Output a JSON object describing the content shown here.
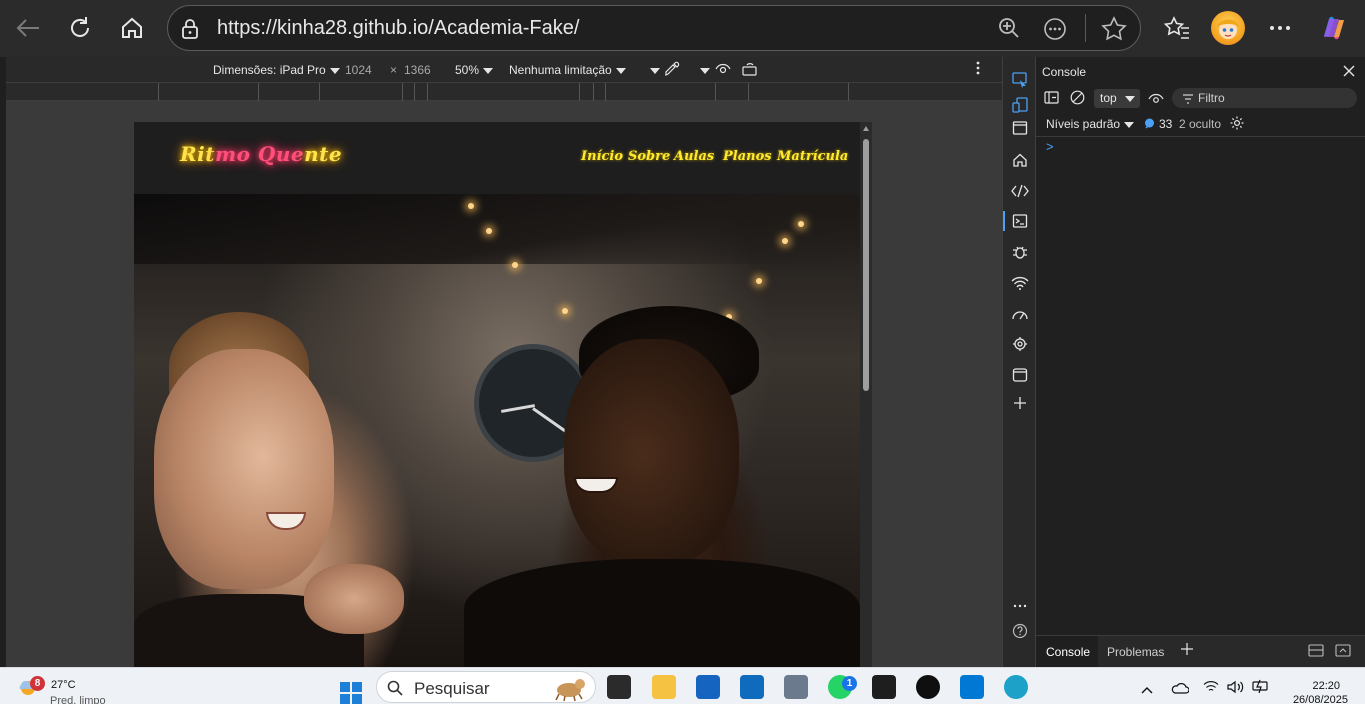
{
  "browser": {
    "url": "https://kinha28.github.io/Academia-Fake/",
    "icons": [
      "back-icon",
      "refresh-icon",
      "home-icon",
      "lock-icon",
      "zoom-icon",
      "more-circle-icon",
      "star-icon",
      "favorites-icon",
      "avatar",
      "more-icon",
      "copilot-icon"
    ]
  },
  "device_toolbar": {
    "dimensions_label": "Dimensões: iPad Pro",
    "width": "1024",
    "times": "×",
    "height": "1366",
    "zoom": "50%",
    "throttle": "Nenhuma limitação"
  },
  "site": {
    "logo_part1": "Rit",
    "logo_part2": "mo Que",
    "logo_part3": "nte",
    "nav": [
      "Início",
      "Sobre",
      "Aulas",
      "Planos",
      "Matrícula"
    ]
  },
  "devtools": {
    "title": "Console",
    "context": "top",
    "filter_placeholder": "Filtro",
    "levels": "Níveis padrão",
    "message_count": "33",
    "hidden": "2 oculto",
    "prompt": ">",
    "tabs": [
      "Console",
      "Problemas"
    ]
  },
  "taskbar": {
    "weather_badge": "8",
    "temperature": "27°C",
    "weather_text": "Pred. limpo",
    "search_placeholder": "Pesquisar",
    "whatsapp_badge": "1",
    "time": "22:20",
    "date": "26/08/2025"
  },
  "colors": {
    "accent": "#4ca0f5",
    "logo_yellow": "#ffe44d",
    "logo_pink": "#ff4f7a",
    "nav_yellow": "#ffea2e"
  }
}
